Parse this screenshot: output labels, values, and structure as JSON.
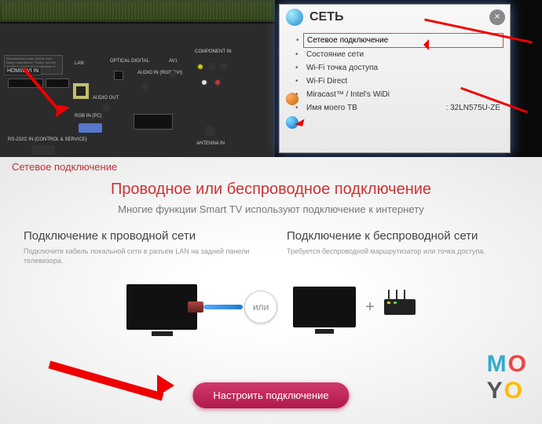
{
  "ports": {
    "hdmi_label": "HDMI/DVI IN",
    "lan_label": "LAN",
    "optical_label": "OPTICAL DIGITAL",
    "audio_in": "AUDIO IN (RGB/DVI)",
    "audio_out": "AUDIO OUT",
    "rgb_in": "RGB IN (PC)",
    "rs232": "RS-232C IN (CONTROL & SERVICE)",
    "av1": "AV1",
    "component": "COMPONENT IN",
    "antenna": "ANTENNA IN",
    "dolby": "Manufactured under license from Dolby Laboratories. \"Dolby\" and the double-D symbol are trademarks of Dolby"
  },
  "menu": {
    "title": "СЕТЬ",
    "items": [
      "Сетевое подключение",
      "Состояние сети",
      "Wi-Fi точка доступа",
      "Wi-Fi Direct",
      "Miracast™ / Intel's WiDi"
    ],
    "tv_name_label": "Имя моего ТВ",
    "tv_name_value": ": 32LN575U-ZE"
  },
  "bottom": {
    "corner": "Сетевое подключение",
    "heading": "Проводное или беспроводное подключение",
    "sub": "Многие функции Smart TV используют подключение к интернету",
    "wired_title": "Подключение к проводной сети",
    "wired_desc": "Подключите кабель локальной сети в разъем LAN на задней панели телевизора.",
    "wireless_title": "Подключение к беспроводной сети",
    "wireless_desc": "Требуется беспроводной маршрутизатор или точка доступа.",
    "or": "или",
    "button": "Настроить подключение"
  },
  "logo": {
    "m": "M",
    "o1": "O",
    "y": "Y",
    "o2": "O"
  }
}
